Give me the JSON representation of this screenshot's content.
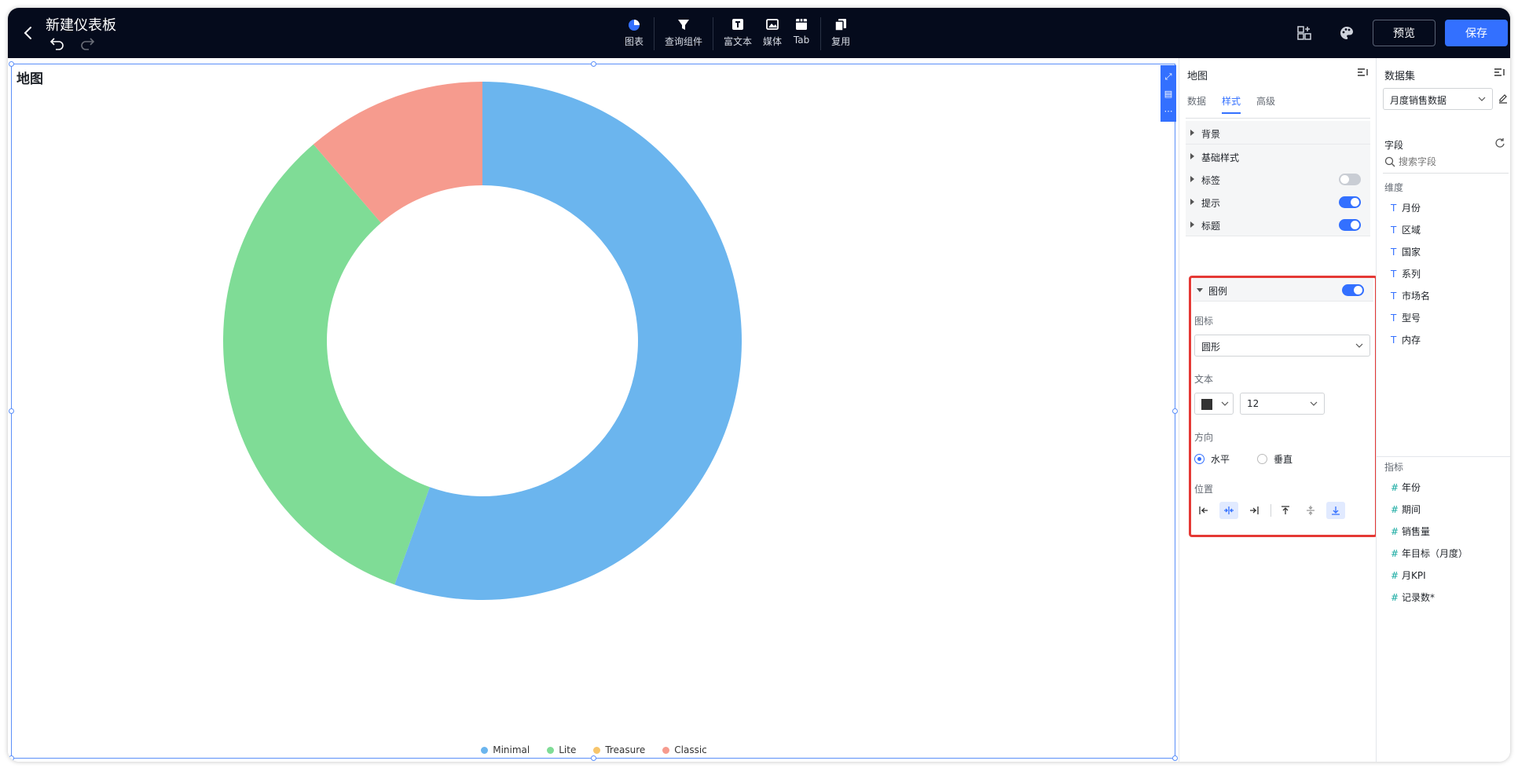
{
  "header": {
    "title": "新建仪表板",
    "tools": [
      {
        "label": "图表",
        "icon": "chart-icon"
      },
      {
        "label": "查询组件",
        "icon": "filter-icon"
      },
      {
        "label": "富文本",
        "icon": "text-icon"
      },
      {
        "label": "媒体",
        "icon": "media-icon"
      },
      {
        "label": "Tab",
        "icon": "tab-icon"
      },
      {
        "label": "复用",
        "icon": "copy-icon"
      }
    ],
    "preview_label": "预览",
    "save_label": "保存"
  },
  "canvas": {
    "chart_title": "地图"
  },
  "chart_data": {
    "type": "pie",
    "donut": true,
    "categories": [
      "Minimal",
      "Lite",
      "Treasure",
      "Classic"
    ],
    "values": [
      55.5,
      33.2,
      0,
      11.3
    ],
    "colors": [
      "#6bb5ee",
      "#7fdc96",
      "#f7c56b",
      "#f69b8e"
    ]
  },
  "style_panel": {
    "title": "地图",
    "tabs": [
      "数据",
      "样式",
      "高级"
    ],
    "active_tab": "样式",
    "sections": [
      {
        "label": "背景"
      },
      {
        "label": "基础样式"
      },
      {
        "label": "标签",
        "toggle": false
      },
      {
        "label": "提示",
        "toggle": true
      },
      {
        "label": "标题",
        "toggle": true
      }
    ],
    "legend": {
      "label": "图例",
      "toggle": true,
      "icon_label": "图标",
      "icon_value": "圆形",
      "text_label": "文本",
      "text_color": "#333333",
      "font_size": "12",
      "direction_label": "方向",
      "direction_options": [
        "水平",
        "垂直"
      ],
      "direction_value": "水平",
      "position_label": "位置"
    }
  },
  "dataset_panel": {
    "title": "数据集",
    "dataset": "月度销售数据",
    "fields_label": "字段",
    "search_placeholder": "搜索字段",
    "dimensions_label": "维度",
    "dimensions": [
      "月份",
      "区域",
      "国家",
      "系列",
      "市场名",
      "型号",
      "内存"
    ],
    "measures_label": "指标",
    "measures": [
      "年份",
      "期间",
      "销售量",
      "年目标（月度）",
      "月KPI",
      "记录数*"
    ]
  }
}
